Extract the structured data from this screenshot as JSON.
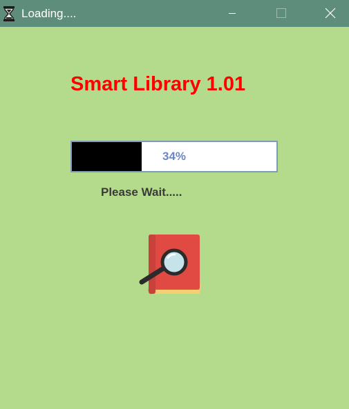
{
  "window": {
    "title": "Loading....",
    "app_icon": "hourglass-icon",
    "controls": [
      "minimize-icon",
      "maximize-icon",
      "close-icon"
    ]
  },
  "main": {
    "app_title": "Smart Library 1.01",
    "progress": {
      "value": 0.34,
      "label": "34%"
    },
    "wait_text": "Please Wait.....",
    "illustration": "book-search-icon"
  },
  "colors": {
    "background": "#b3db8b",
    "titlebar": "#5e8e7b",
    "title_text": "#ff0000",
    "progress_fill": "#000000",
    "progress_text": "#6b86c8"
  }
}
